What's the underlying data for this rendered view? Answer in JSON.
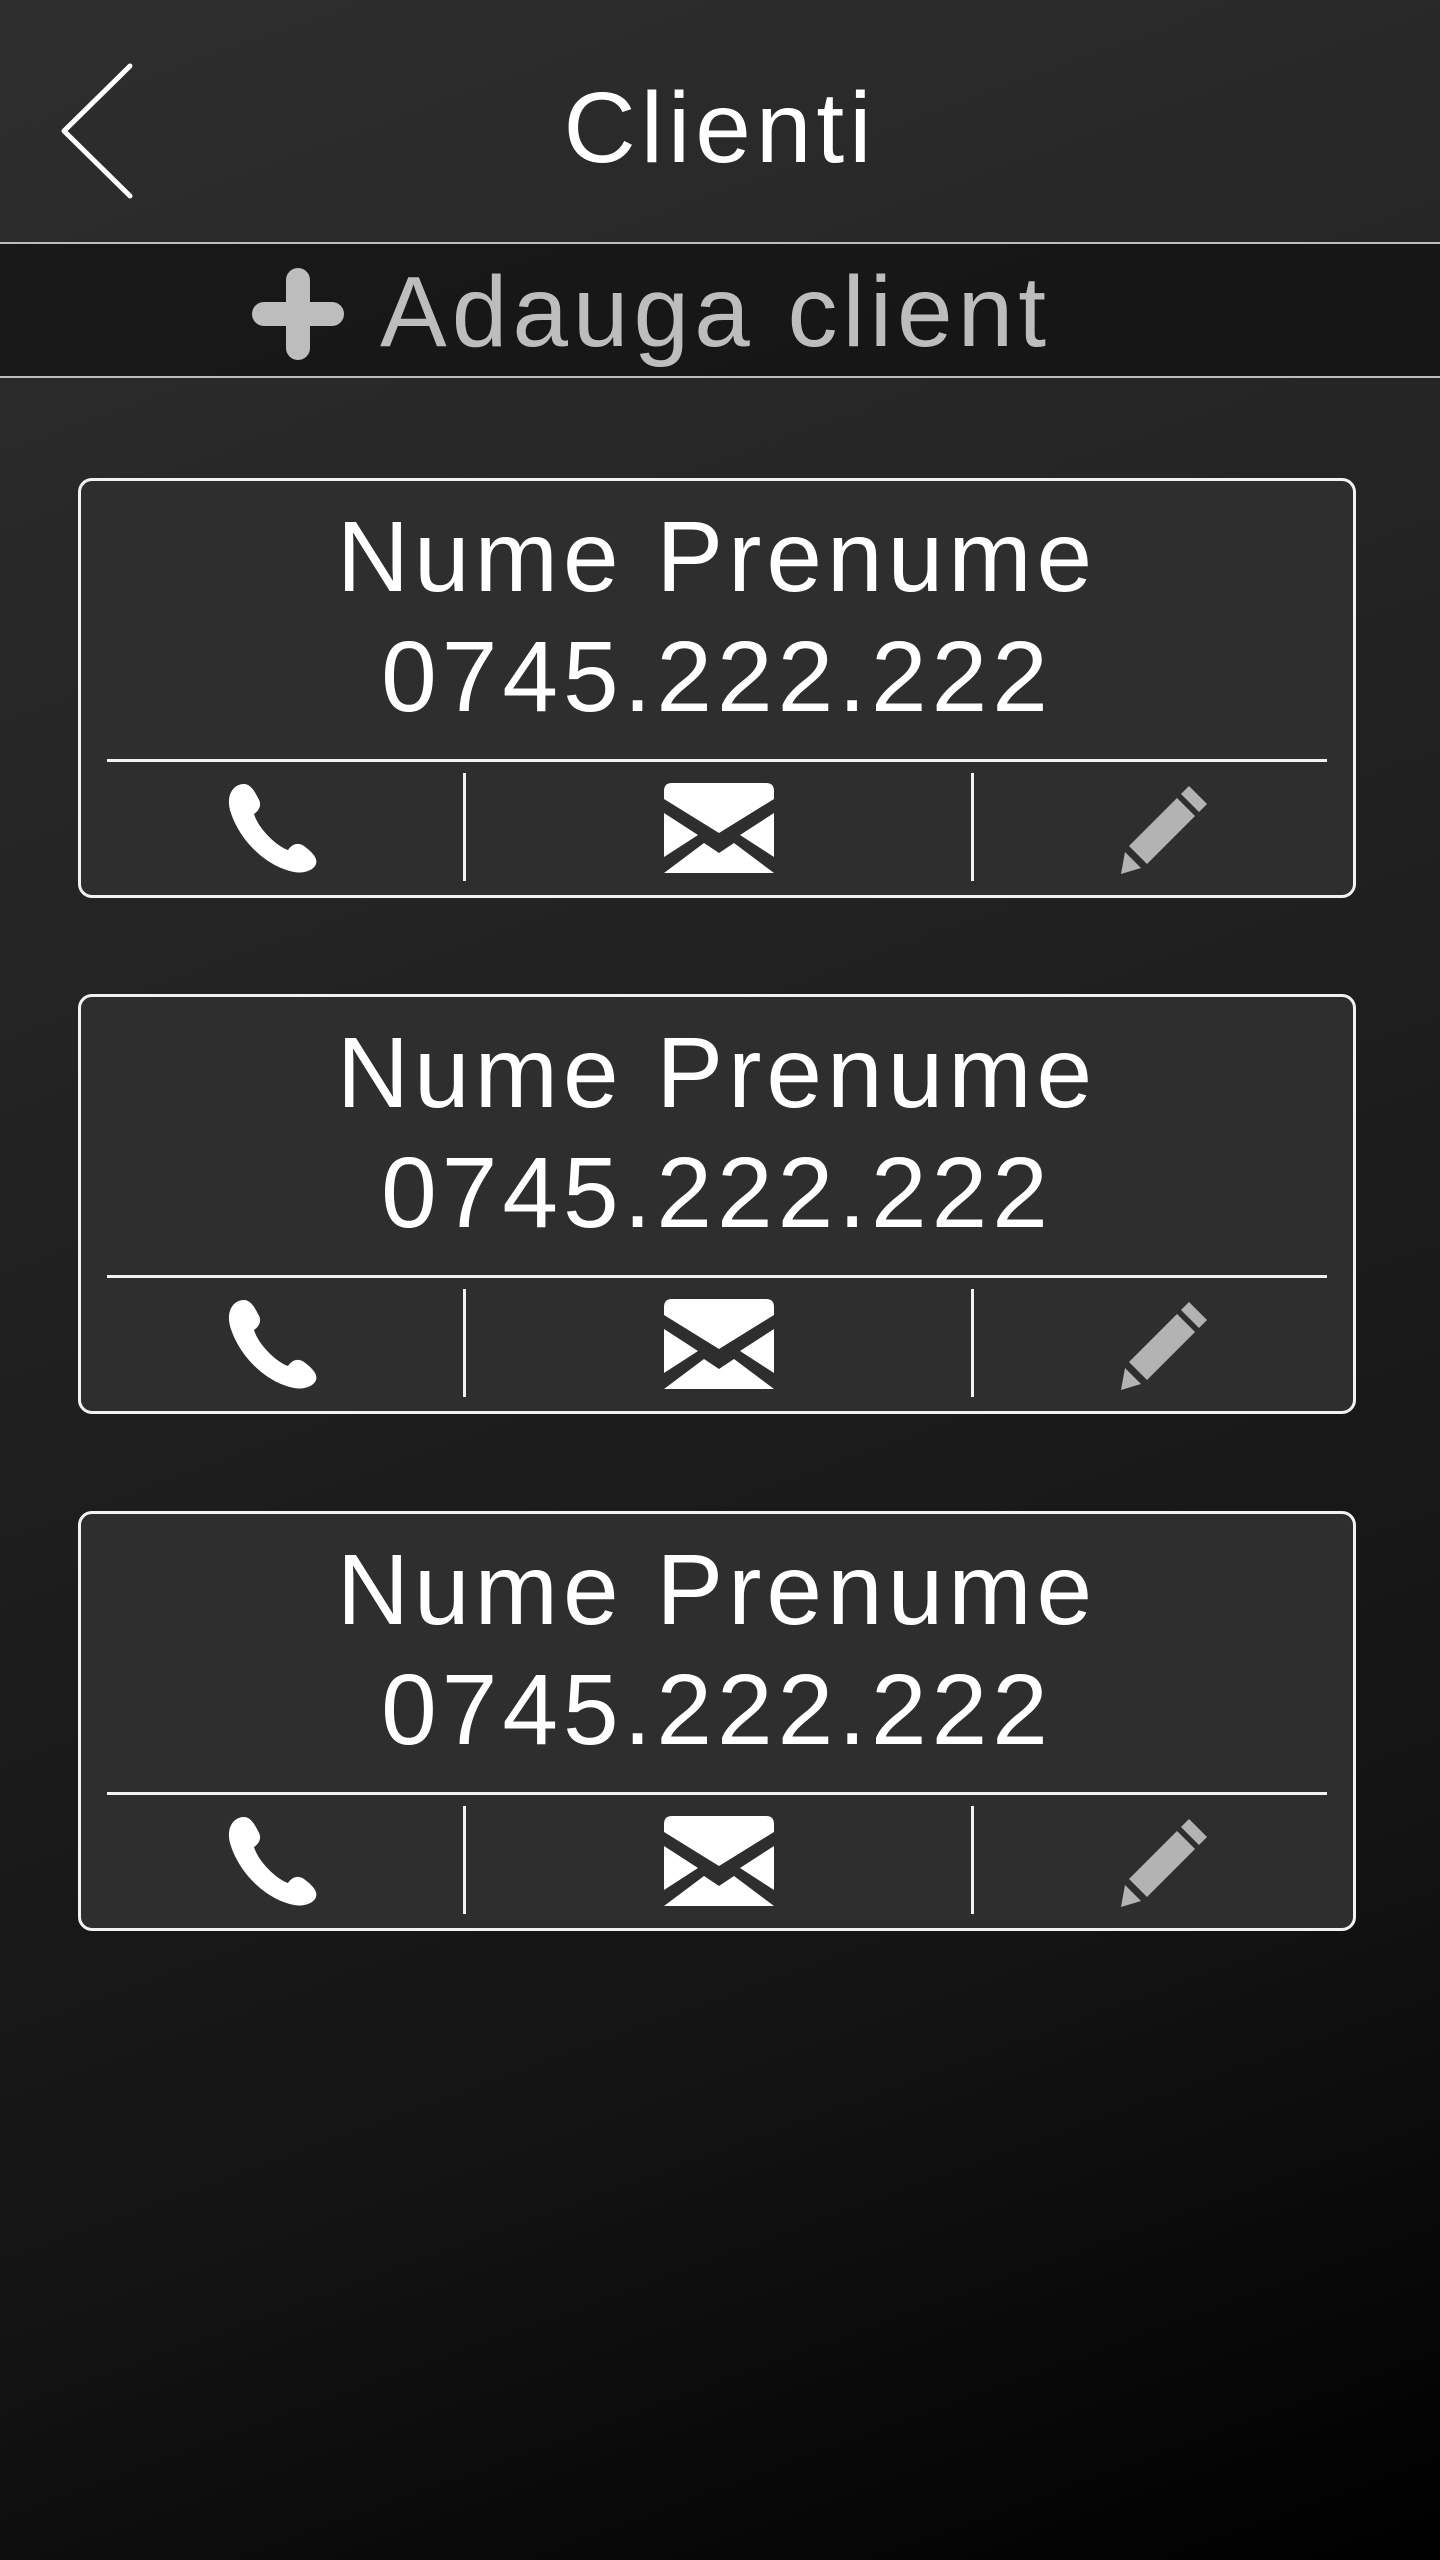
{
  "header": {
    "title": "Clienti",
    "back_icon": "chevron-left-icon"
  },
  "add_client": {
    "label": "Adauga client",
    "icon": "plus-icon",
    "label_color": "#bdbdbd"
  },
  "clients": [
    {
      "name": "Nume Prenume",
      "phone": "0745.222.222"
    },
    {
      "name": "Nume Prenume",
      "phone": "0745.222.222"
    },
    {
      "name": "Nume Prenume",
      "phone": "0745.222.222"
    }
  ],
  "card_actions": [
    {
      "icon": "phone-icon",
      "color": "#ffffff"
    },
    {
      "icon": "envelope-icon",
      "color": "#ffffff"
    },
    {
      "icon": "pencil-icon",
      "color": "#b3b3b3"
    }
  ]
}
